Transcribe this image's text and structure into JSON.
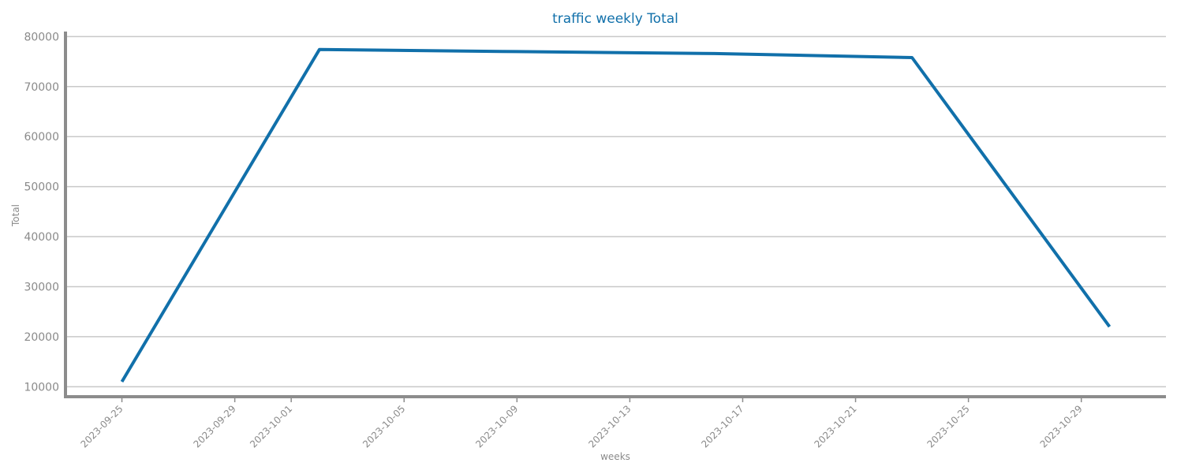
{
  "chart_data": {
    "type": "line",
    "title": "traffic weekly Total",
    "xlabel": "weeks",
    "ylabel": "Total",
    "x_ticks": [
      "2023-09-25",
      "2023-09-29",
      "2023-10-01",
      "2023-10-05",
      "2023-10-09",
      "2023-10-13",
      "2023-10-17",
      "2023-10-21",
      "2023-10-25",
      "2023-10-29"
    ],
    "y_ticks": [
      10000,
      20000,
      30000,
      40000,
      50000,
      60000,
      70000,
      80000
    ],
    "ylim": [
      8000,
      81000
    ],
    "xlim": [
      "2023-09-23",
      "2023-11-01"
    ],
    "grid": "horizontal",
    "series": [
      {
        "x": [
          "2023-09-25",
          "2023-10-02",
          "2023-10-09",
          "2023-10-16",
          "2023-10-23",
          "2023-10-30"
        ],
        "values": [
          11000,
          77400,
          77000,
          76600,
          75800,
          22000
        ]
      }
    ],
    "colors": {
      "line": "#1170aa",
      "title": "#1170aa",
      "grid": "#c8c8c8",
      "axis": "#8c8c8c",
      "text": "#8a8a8a"
    }
  }
}
